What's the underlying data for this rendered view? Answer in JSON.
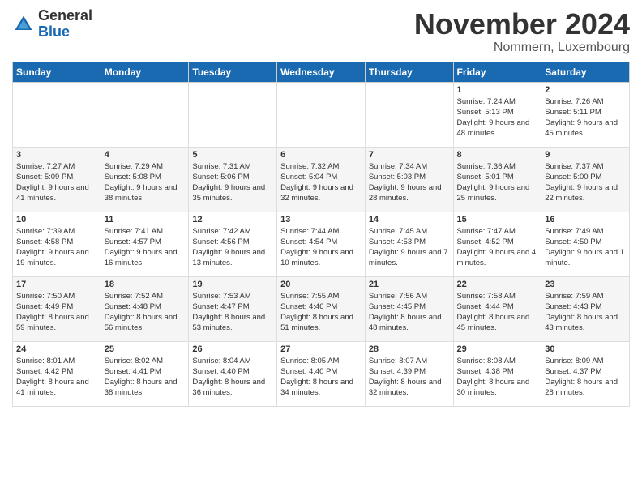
{
  "logo": {
    "general": "General",
    "blue": "Blue"
  },
  "header": {
    "month": "November 2024",
    "location": "Nommern, Luxembourg"
  },
  "weekdays": [
    "Sunday",
    "Monday",
    "Tuesday",
    "Wednesday",
    "Thursday",
    "Friday",
    "Saturday"
  ],
  "weeks": [
    [
      {
        "day": "",
        "info": ""
      },
      {
        "day": "",
        "info": ""
      },
      {
        "day": "",
        "info": ""
      },
      {
        "day": "",
        "info": ""
      },
      {
        "day": "",
        "info": ""
      },
      {
        "day": "1",
        "info": "Sunrise: 7:24 AM\nSunset: 5:13 PM\nDaylight: 9 hours and 48 minutes."
      },
      {
        "day": "2",
        "info": "Sunrise: 7:26 AM\nSunset: 5:11 PM\nDaylight: 9 hours and 45 minutes."
      }
    ],
    [
      {
        "day": "3",
        "info": "Sunrise: 7:27 AM\nSunset: 5:09 PM\nDaylight: 9 hours and 41 minutes."
      },
      {
        "day": "4",
        "info": "Sunrise: 7:29 AM\nSunset: 5:08 PM\nDaylight: 9 hours and 38 minutes."
      },
      {
        "day": "5",
        "info": "Sunrise: 7:31 AM\nSunset: 5:06 PM\nDaylight: 9 hours and 35 minutes."
      },
      {
        "day": "6",
        "info": "Sunrise: 7:32 AM\nSunset: 5:04 PM\nDaylight: 9 hours and 32 minutes."
      },
      {
        "day": "7",
        "info": "Sunrise: 7:34 AM\nSunset: 5:03 PM\nDaylight: 9 hours and 28 minutes."
      },
      {
        "day": "8",
        "info": "Sunrise: 7:36 AM\nSunset: 5:01 PM\nDaylight: 9 hours and 25 minutes."
      },
      {
        "day": "9",
        "info": "Sunrise: 7:37 AM\nSunset: 5:00 PM\nDaylight: 9 hours and 22 minutes."
      }
    ],
    [
      {
        "day": "10",
        "info": "Sunrise: 7:39 AM\nSunset: 4:58 PM\nDaylight: 9 hours and 19 minutes."
      },
      {
        "day": "11",
        "info": "Sunrise: 7:41 AM\nSunset: 4:57 PM\nDaylight: 9 hours and 16 minutes."
      },
      {
        "day": "12",
        "info": "Sunrise: 7:42 AM\nSunset: 4:56 PM\nDaylight: 9 hours and 13 minutes."
      },
      {
        "day": "13",
        "info": "Sunrise: 7:44 AM\nSunset: 4:54 PM\nDaylight: 9 hours and 10 minutes."
      },
      {
        "day": "14",
        "info": "Sunrise: 7:45 AM\nSunset: 4:53 PM\nDaylight: 9 hours and 7 minutes."
      },
      {
        "day": "15",
        "info": "Sunrise: 7:47 AM\nSunset: 4:52 PM\nDaylight: 9 hours and 4 minutes."
      },
      {
        "day": "16",
        "info": "Sunrise: 7:49 AM\nSunset: 4:50 PM\nDaylight: 9 hours and 1 minute."
      }
    ],
    [
      {
        "day": "17",
        "info": "Sunrise: 7:50 AM\nSunset: 4:49 PM\nDaylight: 8 hours and 59 minutes."
      },
      {
        "day": "18",
        "info": "Sunrise: 7:52 AM\nSunset: 4:48 PM\nDaylight: 8 hours and 56 minutes."
      },
      {
        "day": "19",
        "info": "Sunrise: 7:53 AM\nSunset: 4:47 PM\nDaylight: 8 hours and 53 minutes."
      },
      {
        "day": "20",
        "info": "Sunrise: 7:55 AM\nSunset: 4:46 PM\nDaylight: 8 hours and 51 minutes."
      },
      {
        "day": "21",
        "info": "Sunrise: 7:56 AM\nSunset: 4:45 PM\nDaylight: 8 hours and 48 minutes."
      },
      {
        "day": "22",
        "info": "Sunrise: 7:58 AM\nSunset: 4:44 PM\nDaylight: 8 hours and 45 minutes."
      },
      {
        "day": "23",
        "info": "Sunrise: 7:59 AM\nSunset: 4:43 PM\nDaylight: 8 hours and 43 minutes."
      }
    ],
    [
      {
        "day": "24",
        "info": "Sunrise: 8:01 AM\nSunset: 4:42 PM\nDaylight: 8 hours and 41 minutes."
      },
      {
        "day": "25",
        "info": "Sunrise: 8:02 AM\nSunset: 4:41 PM\nDaylight: 8 hours and 38 minutes."
      },
      {
        "day": "26",
        "info": "Sunrise: 8:04 AM\nSunset: 4:40 PM\nDaylight: 8 hours and 36 minutes."
      },
      {
        "day": "27",
        "info": "Sunrise: 8:05 AM\nSunset: 4:40 PM\nDaylight: 8 hours and 34 minutes."
      },
      {
        "day": "28",
        "info": "Sunrise: 8:07 AM\nSunset: 4:39 PM\nDaylight: 8 hours and 32 minutes."
      },
      {
        "day": "29",
        "info": "Sunrise: 8:08 AM\nSunset: 4:38 PM\nDaylight: 8 hours and 30 minutes."
      },
      {
        "day": "30",
        "info": "Sunrise: 8:09 AM\nSunset: 4:37 PM\nDaylight: 8 hours and 28 minutes."
      }
    ]
  ]
}
